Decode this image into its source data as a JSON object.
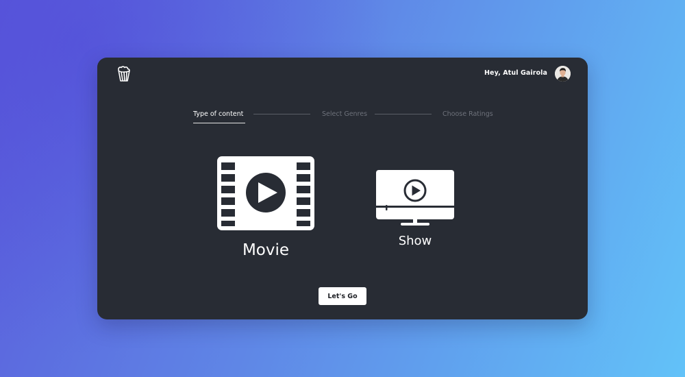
{
  "header": {
    "logo_icon": "popcorn-logo-icon",
    "greeting": "Hey, Atul Gairola",
    "avatar_icon": "user-avatar"
  },
  "steps": [
    {
      "label": "Type of content",
      "active": true
    },
    {
      "label": "Select Genres",
      "active": false
    },
    {
      "label": "Choose Ratings",
      "active": false
    }
  ],
  "options": [
    {
      "label": "Movie",
      "icon": "film-strip-play-icon"
    },
    {
      "label": "Show",
      "icon": "tv-play-icon"
    }
  ],
  "cta": {
    "label": "Let's Go"
  },
  "colors": {
    "card_bg": "#282c34",
    "accent_text": "#ffffff",
    "muted_text": "#6e727b",
    "bg_gradient_start": "#5a5bdb",
    "bg_gradient_end": "#62c2f8"
  }
}
